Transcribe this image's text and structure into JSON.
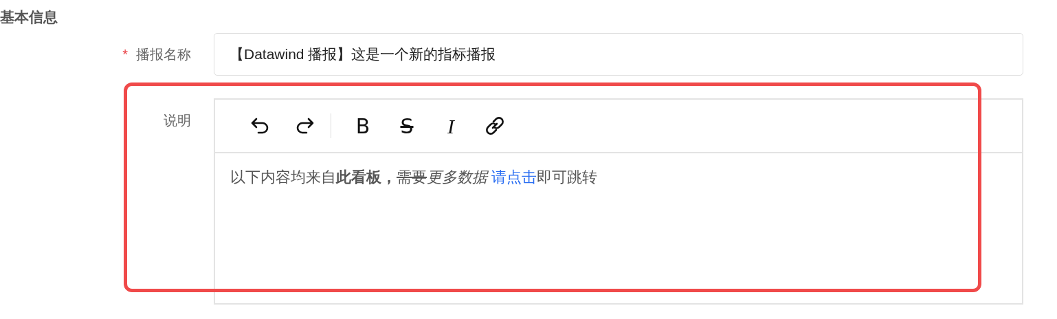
{
  "section_title": "基本信息",
  "fields": [
    {
      "kind": "input",
      "label": "播报名称",
      "required_mark": "*",
      "value": "【Datawind 播报】这是一个新的指标播报"
    },
    {
      "kind": "editor",
      "label": "说明",
      "toolbar": [
        {
          "kind": "undo"
        },
        {
          "kind": "redo"
        },
        {
          "kind": "separator"
        },
        {
          "kind": "bold",
          "label": "B"
        },
        {
          "kind": "strike",
          "label": "S"
        },
        {
          "kind": "italic",
          "label": "I"
        },
        {
          "kind": "link"
        }
      ],
      "content": [
        {
          "kind": "plain",
          "text": "以下内容均来自"
        },
        {
          "kind": "bold",
          "text": "此看板，"
        },
        {
          "kind": "strike",
          "text": "需要"
        },
        {
          "kind": "italic",
          "text": "更多数据 "
        },
        {
          "kind": "link",
          "text": "请点击"
        },
        {
          "kind": "plain",
          "text": "即可跳转"
        }
      ]
    }
  ],
  "highlight": {
    "color": "#f04a4a"
  }
}
